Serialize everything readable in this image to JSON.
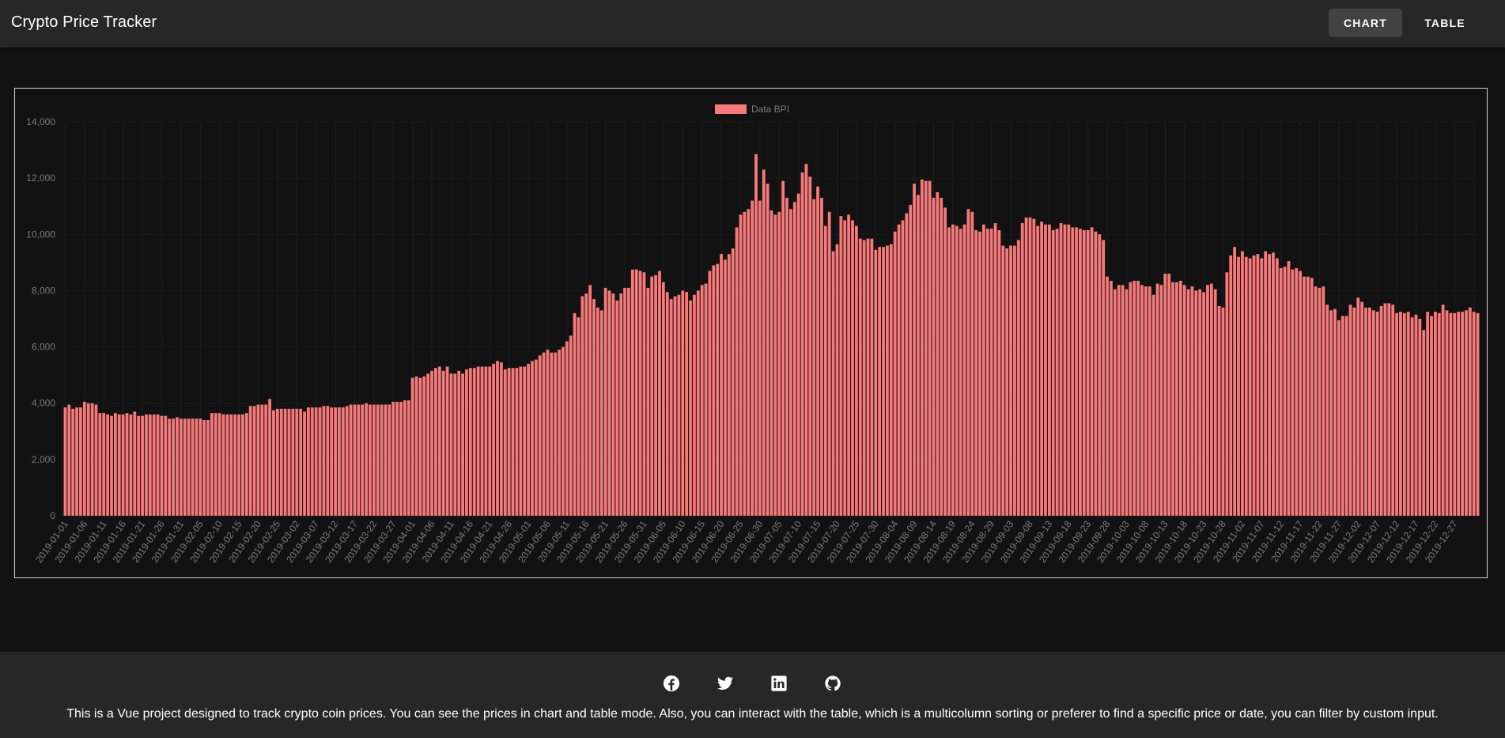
{
  "header": {
    "title": "Crypto Price Tracker",
    "nav": [
      {
        "label": "CHART",
        "active": true
      },
      {
        "label": "TABLE",
        "active": false
      }
    ]
  },
  "chart_data": {
    "type": "bar",
    "title": "",
    "legend": {
      "label": "Data BPI",
      "position": "top-center"
    },
    "color": "#f87979",
    "start_date": "2019-01-01",
    "label_every_days": 5,
    "ylim": [
      0,
      14000
    ],
    "yticks": [
      0,
      2000,
      4000,
      6000,
      8000,
      10000,
      12000,
      14000
    ],
    "grid": true,
    "x_tick_labels": [
      "2019-01-01",
      "2019-01-06",
      "2019-01-11",
      "2019-01-16",
      "2019-01-21",
      "2019-01-26",
      "2019-01-31",
      "2019-02-05",
      "2019-02-10",
      "2019-02-15",
      "2019-02-20",
      "2019-02-25",
      "2019-03-02",
      "2019-03-07",
      "2019-03-12",
      "2019-03-17",
      "2019-03-22",
      "2019-03-27",
      "2019-04-01",
      "2019-04-06",
      "2019-04-11",
      "2019-04-16",
      "2019-04-21",
      "2019-04-26",
      "2019-05-01",
      "2019-05-06",
      "2019-05-11",
      "2019-05-16",
      "2019-05-21",
      "2019-05-26",
      "2019-05-31",
      "2019-06-05",
      "2019-06-10",
      "2019-06-15",
      "2019-06-20",
      "2019-06-25",
      "2019-06-30",
      "2019-07-05",
      "2019-07-10",
      "2019-07-15",
      "2019-07-20",
      "2019-07-25",
      "2019-07-30",
      "2019-08-04",
      "2019-08-09",
      "2019-08-14",
      "2019-08-19",
      "2019-08-24",
      "2019-08-29",
      "2019-09-03",
      "2019-09-08",
      "2019-09-13",
      "2019-09-18",
      "2019-09-23",
      "2019-09-28",
      "2019-10-03",
      "2019-10-08",
      "2019-10-13",
      "2019-10-18",
      "2019-10-23",
      "2019-10-28",
      "2019-11-02",
      "2019-11-07",
      "2019-11-12",
      "2019-11-17",
      "2019-11-22",
      "2019-11-27",
      "2019-12-02",
      "2019-12-07",
      "2019-12-12",
      "2019-12-17",
      "2019-12-22",
      "2019-12-27"
    ],
    "x": [
      "2019-01-01",
      "2019-01-02",
      "2019-01-03",
      "2019-01-04",
      "2019-01-05",
      "2019-01-06",
      "2019-01-07",
      "2019-01-08",
      "2019-01-09",
      "2019-01-10",
      "2019-01-11",
      "2019-01-12",
      "2019-01-13",
      "2019-01-14",
      "2019-01-15",
      "2019-01-16",
      "2019-01-17",
      "2019-01-18",
      "2019-01-19",
      "2019-01-20",
      "2019-01-21",
      "2019-01-22",
      "2019-01-23",
      "2019-01-24",
      "2019-01-25",
      "2019-01-26",
      "2019-01-27",
      "2019-01-28",
      "2019-01-29",
      "2019-01-30",
      "2019-01-31",
      "2019-02-01",
      "2019-02-02",
      "2019-02-03",
      "2019-02-04",
      "2019-02-05",
      "2019-02-06",
      "2019-02-07",
      "2019-02-08",
      "2019-02-09",
      "2019-02-10",
      "2019-02-11",
      "2019-02-12",
      "2019-02-13",
      "2019-02-14",
      "2019-02-15",
      "2019-02-16",
      "2019-02-17",
      "2019-02-18",
      "2019-02-19",
      "2019-02-20",
      "2019-02-21",
      "2019-02-22",
      "2019-02-23",
      "2019-02-24",
      "2019-02-25",
      "2019-02-26",
      "2019-02-27",
      "2019-02-28",
      "2019-03-01",
      "2019-03-02",
      "2019-03-03",
      "2019-03-04",
      "2019-03-05",
      "2019-03-06",
      "2019-03-07",
      "2019-03-08",
      "2019-03-09",
      "2019-03-10",
      "2019-03-11",
      "2019-03-12",
      "2019-03-13",
      "2019-03-14",
      "2019-03-15",
      "2019-03-16",
      "2019-03-17",
      "2019-03-18",
      "2019-03-19",
      "2019-03-20",
      "2019-03-21",
      "2019-03-22",
      "2019-03-23",
      "2019-03-24",
      "2019-03-25",
      "2019-03-26",
      "2019-03-27",
      "2019-03-28",
      "2019-03-29",
      "2019-03-30",
      "2019-03-31",
      "2019-04-01",
      "2019-04-02",
      "2019-04-03",
      "2019-04-04",
      "2019-04-05",
      "2019-04-06",
      "2019-04-07",
      "2019-04-08",
      "2019-04-09",
      "2019-04-10",
      "2019-04-11",
      "2019-04-12",
      "2019-04-13",
      "2019-04-14",
      "2019-04-15",
      "2019-04-16",
      "2019-04-17",
      "2019-04-18",
      "2019-04-19",
      "2019-04-20",
      "2019-04-21",
      "2019-04-22",
      "2019-04-23",
      "2019-04-24",
      "2019-04-25",
      "2019-04-26",
      "2019-04-27",
      "2019-04-28",
      "2019-04-29",
      "2019-04-30",
      "2019-05-01",
      "2019-05-02",
      "2019-05-03",
      "2019-05-04",
      "2019-05-05",
      "2019-05-06",
      "2019-05-07",
      "2019-05-08",
      "2019-05-09",
      "2019-05-10",
      "2019-05-11",
      "2019-05-12",
      "2019-05-13",
      "2019-05-14",
      "2019-05-15",
      "2019-05-16",
      "2019-05-17",
      "2019-05-18",
      "2019-05-19",
      "2019-05-20",
      "2019-05-21",
      "2019-05-22",
      "2019-05-23",
      "2019-05-24",
      "2019-05-25",
      "2019-05-26",
      "2019-05-27",
      "2019-05-28",
      "2019-05-29",
      "2019-05-30",
      "2019-05-31",
      "2019-06-01",
      "2019-06-02",
      "2019-06-03",
      "2019-06-04",
      "2019-06-05",
      "2019-06-06",
      "2019-06-07",
      "2019-06-08",
      "2019-06-09",
      "2019-06-10",
      "2019-06-11",
      "2019-06-12",
      "2019-06-13",
      "2019-06-14",
      "2019-06-15",
      "2019-06-16",
      "2019-06-17",
      "2019-06-18",
      "2019-06-19",
      "2019-06-20",
      "2019-06-21",
      "2019-06-22",
      "2019-06-23",
      "2019-06-24",
      "2019-06-25",
      "2019-06-26",
      "2019-06-27",
      "2019-06-28",
      "2019-06-29",
      "2019-06-30",
      "2019-07-01",
      "2019-07-02",
      "2019-07-03",
      "2019-07-04",
      "2019-07-05",
      "2019-07-06",
      "2019-07-07",
      "2019-07-08",
      "2019-07-09",
      "2019-07-10",
      "2019-07-11",
      "2019-07-12",
      "2019-07-13",
      "2019-07-14",
      "2019-07-15",
      "2019-07-16",
      "2019-07-17",
      "2019-07-18",
      "2019-07-19",
      "2019-07-20",
      "2019-07-21",
      "2019-07-22",
      "2019-07-23",
      "2019-07-24",
      "2019-07-25",
      "2019-07-26",
      "2019-07-27",
      "2019-07-28",
      "2019-07-29",
      "2019-07-30",
      "2019-07-31",
      "2019-08-01",
      "2019-08-02",
      "2019-08-03",
      "2019-08-04",
      "2019-08-05",
      "2019-08-06",
      "2019-08-07",
      "2019-08-08",
      "2019-08-09",
      "2019-08-10",
      "2019-08-11",
      "2019-08-12",
      "2019-08-13",
      "2019-08-14",
      "2019-08-15",
      "2019-08-16",
      "2019-08-17",
      "2019-08-18",
      "2019-08-19",
      "2019-08-20",
      "2019-08-21",
      "2019-08-22",
      "2019-08-23",
      "2019-08-24",
      "2019-08-25",
      "2019-08-26",
      "2019-08-27",
      "2019-08-28",
      "2019-08-29",
      "2019-08-30",
      "2019-08-31",
      "2019-09-01",
      "2019-09-02",
      "2019-09-03",
      "2019-09-04",
      "2019-09-05",
      "2019-09-06",
      "2019-09-07",
      "2019-09-08",
      "2019-09-09",
      "2019-09-10",
      "2019-09-11",
      "2019-09-12",
      "2019-09-13",
      "2019-09-14",
      "2019-09-15",
      "2019-09-16",
      "2019-09-17",
      "2019-09-18",
      "2019-09-19",
      "2019-09-20",
      "2019-09-21",
      "2019-09-22",
      "2019-09-23",
      "2019-09-24",
      "2019-09-25",
      "2019-09-26",
      "2019-09-27",
      "2019-09-28",
      "2019-09-29",
      "2019-09-30",
      "2019-10-01",
      "2019-10-02",
      "2019-10-03",
      "2019-10-04",
      "2019-10-05",
      "2019-10-06",
      "2019-10-07",
      "2019-10-08",
      "2019-10-09",
      "2019-10-10",
      "2019-10-11",
      "2019-10-12",
      "2019-10-13",
      "2019-10-14",
      "2019-10-15",
      "2019-10-16",
      "2019-10-17",
      "2019-10-18",
      "2019-10-19",
      "2019-10-20",
      "2019-10-21",
      "2019-10-22",
      "2019-10-23",
      "2019-10-24",
      "2019-10-25",
      "2019-10-26",
      "2019-10-27",
      "2019-10-28",
      "2019-10-29",
      "2019-10-30",
      "2019-10-31",
      "2019-11-01",
      "2019-11-02",
      "2019-11-03",
      "2019-11-04",
      "2019-11-05",
      "2019-11-06",
      "2019-11-07",
      "2019-11-08",
      "2019-11-09",
      "2019-11-10",
      "2019-11-11",
      "2019-11-12",
      "2019-11-13",
      "2019-11-14",
      "2019-11-15",
      "2019-11-16",
      "2019-11-17",
      "2019-11-18",
      "2019-11-19",
      "2019-11-20",
      "2019-11-21",
      "2019-11-22",
      "2019-11-23",
      "2019-11-24",
      "2019-11-25",
      "2019-11-26",
      "2019-11-27",
      "2019-11-28",
      "2019-11-29",
      "2019-11-30",
      "2019-12-01",
      "2019-12-02",
      "2019-12-03",
      "2019-12-04",
      "2019-12-05",
      "2019-12-06",
      "2019-12-07",
      "2019-12-08",
      "2019-12-09",
      "2019-12-10",
      "2019-12-11",
      "2019-12-12",
      "2019-12-13",
      "2019-12-14",
      "2019-12-15",
      "2019-12-16",
      "2019-12-17",
      "2019-12-18",
      "2019-12-19",
      "2019-12-20",
      "2019-12-21",
      "2019-12-22",
      "2019-12-23",
      "2019-12-24",
      "2019-12-25",
      "2019-12-26",
      "2019-12-27",
      "2019-12-28",
      "2019-12-29",
      "2019-12-30",
      "2019-12-31"
    ],
    "values": [
      3850,
      3950,
      3800,
      3850,
      3850,
      4050,
      4000,
      4000,
      3950,
      3650,
      3650,
      3600,
      3550,
      3650,
      3600,
      3600,
      3650,
      3600,
      3700,
      3550,
      3550,
      3600,
      3600,
      3600,
      3600,
      3550,
      3550,
      3450,
      3450,
      3500,
      3450,
      3450,
      3450,
      3450,
      3450,
      3450,
      3400,
      3400,
      3650,
      3650,
      3650,
      3600,
      3600,
      3600,
      3600,
      3600,
      3600,
      3650,
      3900,
      3900,
      3950,
      3950,
      3950,
      4150,
      3750,
      3800,
      3800,
      3800,
      3800,
      3800,
      3800,
      3800,
      3700,
      3850,
      3850,
      3850,
      3850,
      3900,
      3900,
      3850,
      3850,
      3850,
      3850,
      3900,
      3950,
      3950,
      3950,
      3950,
      4000,
      3950,
      3950,
      3950,
      3950,
      3950,
      3950,
      4050,
      4050,
      4050,
      4100,
      4100,
      4900,
      4950,
      4900,
      4950,
      5050,
      5150,
      5250,
      5300,
      5150,
      5300,
      5050,
      5050,
      5150,
      5050,
      5200,
      5250,
      5250,
      5300,
      5300,
      5300,
      5300,
      5400,
      5500,
      5450,
      5200,
      5250,
      5250,
      5250,
      5300,
      5300,
      5400,
      5500,
      5550,
      5700,
      5800,
      5900,
      5800,
      5800,
      5900,
      6000,
      6200,
      6400,
      7200,
      7050,
      7800,
      7900,
      8200,
      7700,
      7400,
      7300,
      8100,
      8000,
      7900,
      7650,
      7900,
      8100,
      8100,
      8750,
      8750,
      8700,
      8650,
      8100,
      8500,
      8550,
      8700,
      8300,
      7950,
      7700,
      7800,
      7850,
      8000,
      7950,
      7650,
      7850,
      8000,
      8200,
      8250,
      8700,
      8900,
      8950,
      9300,
      9100,
      9300,
      9500,
      10250,
      10700,
      10800,
      10900,
      11200,
      12850,
      11200,
      12300,
      11800,
      10850,
      10700,
      10800,
      11900,
      11300,
      10900,
      11150,
      11450,
      12200,
      12500,
      12050,
      11250,
      11700,
      11300,
      10300,
      10800,
      9400,
      9650,
      10650,
      10500,
      10700,
      10500,
      10300,
      9850,
      9800,
      9850,
      9850,
      9450,
      9550,
      9550,
      9600,
      9650,
      10100,
      10350,
      10500,
      10750,
      11050,
      11800,
      11400,
      11950,
      11900,
      11900,
      11300,
      11500,
      11300,
      10950,
      10250,
      10350,
      10300,
      10200,
      10350,
      10900,
      10800,
      10150,
      10100,
      10350,
      10200,
      10200,
      10400,
      10150,
      9600,
      9500,
      9600,
      9600,
      9800,
      10400,
      10600,
      10600,
      10550,
      10300,
      10450,
      10350,
      10350,
      10150,
      10200,
      10400,
      10350,
      10350,
      10250,
      10250,
      10200,
      10150,
      10150,
      10250,
      10100,
      10000,
      9800,
      8500,
      8350,
      8050,
      8200,
      8200,
      8050,
      8300,
      8350,
      8350,
      8200,
      8150,
      8150,
      7850,
      8250,
      8200,
      8600,
      8600,
      8300,
      8300,
      8350,
      8200,
      8050,
      8150,
      8000,
      8050,
      7950,
      8200,
      8250,
      8050,
      7450,
      7400,
      8650,
      9250,
      9550,
      9200,
      9400,
      9200,
      9150,
      9250,
      9300,
      9150,
      9400,
      9300,
      9350,
      9150,
      8800,
      8850,
      9050,
      8750,
      8800,
      8700,
      8500,
      8500,
      8450,
      8150,
      8100,
      8150,
      7500,
      7300,
      7350,
      6950,
      7100,
      7100,
      7500,
      7400,
      7750,
      7600,
      7400,
      7400,
      7300,
      7250,
      7450,
      7550,
      7550,
      7500,
      7200,
      7250,
      7200,
      7250,
      7050,
      7150,
      7000,
      6600,
      7250,
      7100,
      7250,
      7200,
      7500,
      7300,
      7200,
      7200,
      7250,
      7250,
      7300,
      7400,
      7250,
      7200
    ]
  },
  "footer": {
    "social": [
      {
        "icon": "facebook-icon",
        "label": "Facebook"
      },
      {
        "icon": "twitter-icon",
        "label": "Twitter"
      },
      {
        "icon": "linkedin-icon",
        "label": "LinkedIn"
      },
      {
        "icon": "github-icon",
        "label": "GitHub"
      }
    ],
    "description": "This is a Vue project designed to track crypto coin prices. You can see the prices in chart and table mode. Also, you can interact with the table, which is a multicolumn sorting or preferer to find a specific price or date, you can filter by custom input."
  }
}
